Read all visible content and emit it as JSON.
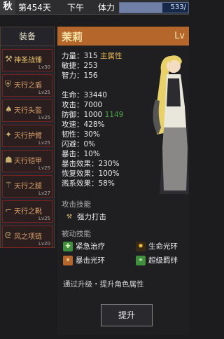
{
  "top": {
    "name_badge": "秋",
    "day": "第454天",
    "time": "下午",
    "stamina_label": "体力",
    "stamina_value": "533/",
    "stamina_fraction": 0.62
  },
  "equipment": {
    "header": "装备",
    "items": [
      {
        "name": "神圣战锤",
        "level": "Lv30",
        "icon": "hammer-icon"
      },
      {
        "name": "天行之盾",
        "level": "Lv25",
        "icon": "shield-icon"
      },
      {
        "name": "天行头盔",
        "level": "Lv25",
        "icon": "helmet-icon"
      },
      {
        "name": "天行护臂",
        "level": "Lv25",
        "icon": "bracer-icon"
      },
      {
        "name": "天行铠甲",
        "level": "Lv25",
        "icon": "armor-icon"
      },
      {
        "name": "天行之腿",
        "level": "Lv27",
        "icon": "legs-icon"
      },
      {
        "name": "天行之靴",
        "level": "Lv25",
        "icon": "boots-icon"
      },
      {
        "name": "风之项链",
        "level": "Lv20",
        "icon": "necklace-icon"
      }
    ]
  },
  "character": {
    "name": "茉莉",
    "level": "Lv",
    "stats": {
      "strength": "力量：315",
      "main_attr": "主属性",
      "agility": "敏捷：253",
      "intellect": "智力：156",
      "hp": "生命：33440",
      "attack": "攻击：7000",
      "defense": "防御：1000",
      "defense_bonus": "1149",
      "attack_speed": "攻速：428%",
      "toughness": "韧性：30%",
      "dodge": "闪避：0%",
      "crit": "暴击：10%",
      "crit_effect": "暴击效果：230%",
      "recovery": "恢复效果：100%",
      "overflow": "溅系效果：58%"
    }
  },
  "skills": {
    "attack_header": "攻击技能",
    "attack_skill": "强力打击",
    "passive_header": "被动技能",
    "passive": [
      {
        "name": "紧急治疗",
        "color": "#3f8f3f"
      },
      {
        "name": "生命光环",
        "color": "#c08a2a"
      },
      {
        "name": "暴击光环",
        "color": "#b5672b"
      },
      {
        "name": "超级羁绊",
        "color": "#3f8f3f"
      }
    ]
  },
  "footer": {
    "note": "通过升级・提升角色属性",
    "upgrade_label": "提升"
  }
}
